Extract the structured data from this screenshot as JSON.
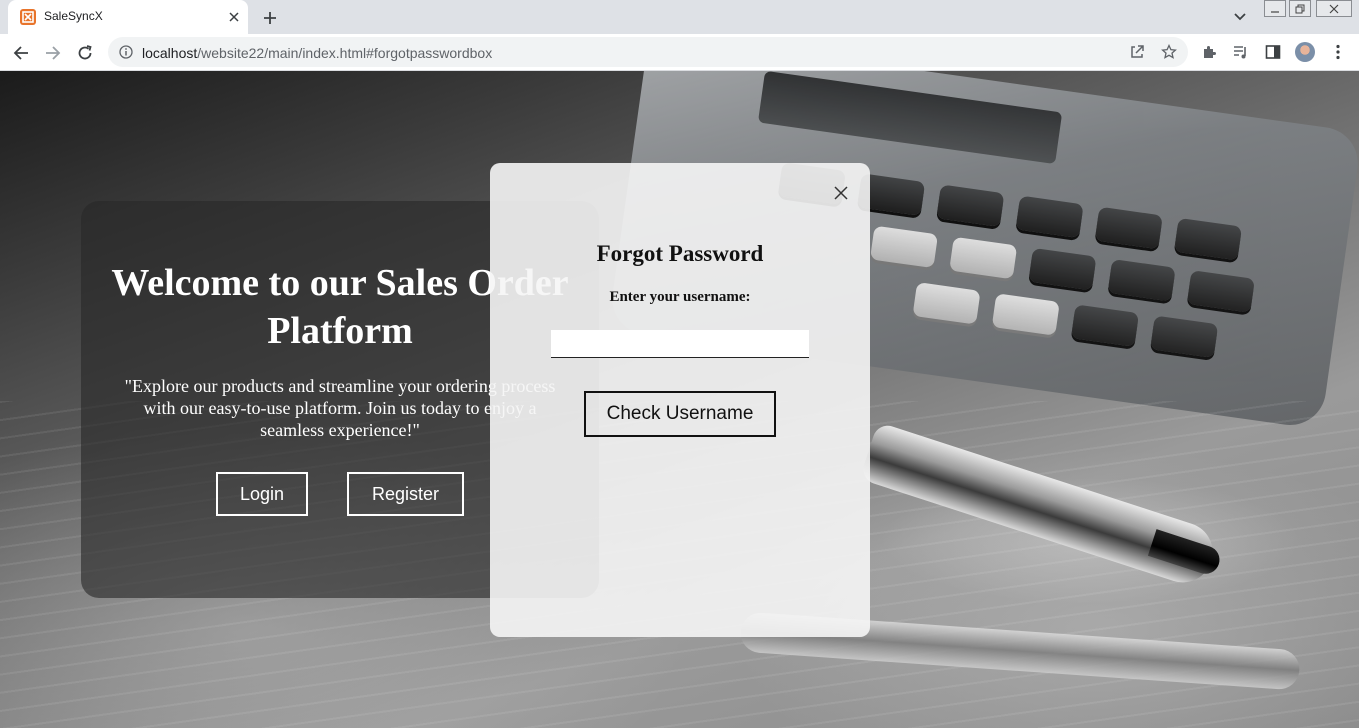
{
  "browser": {
    "tab_title": "SaleSyncX",
    "url_host": "localhost",
    "url_path": "/website22/main/index.html#forgotpasswordbox"
  },
  "welcome": {
    "title": "Welcome to our Sales Order Platform",
    "text": "\"Explore our products and streamline your ordering process with our easy-to-use platform. Join us today to enjoy a seamless experience!\"",
    "login_label": "Login",
    "register_label": "Register"
  },
  "forgot_modal": {
    "title": "Forgot Password",
    "username_label": "Enter your username:",
    "username_value": "",
    "check_button_label": "Check Username"
  },
  "colors": {
    "favicon": "#e8742b",
    "welcome_panel": "rgba(40,40,40,0.62)",
    "modal_bg": "rgba(245,245,245,0.90)"
  }
}
